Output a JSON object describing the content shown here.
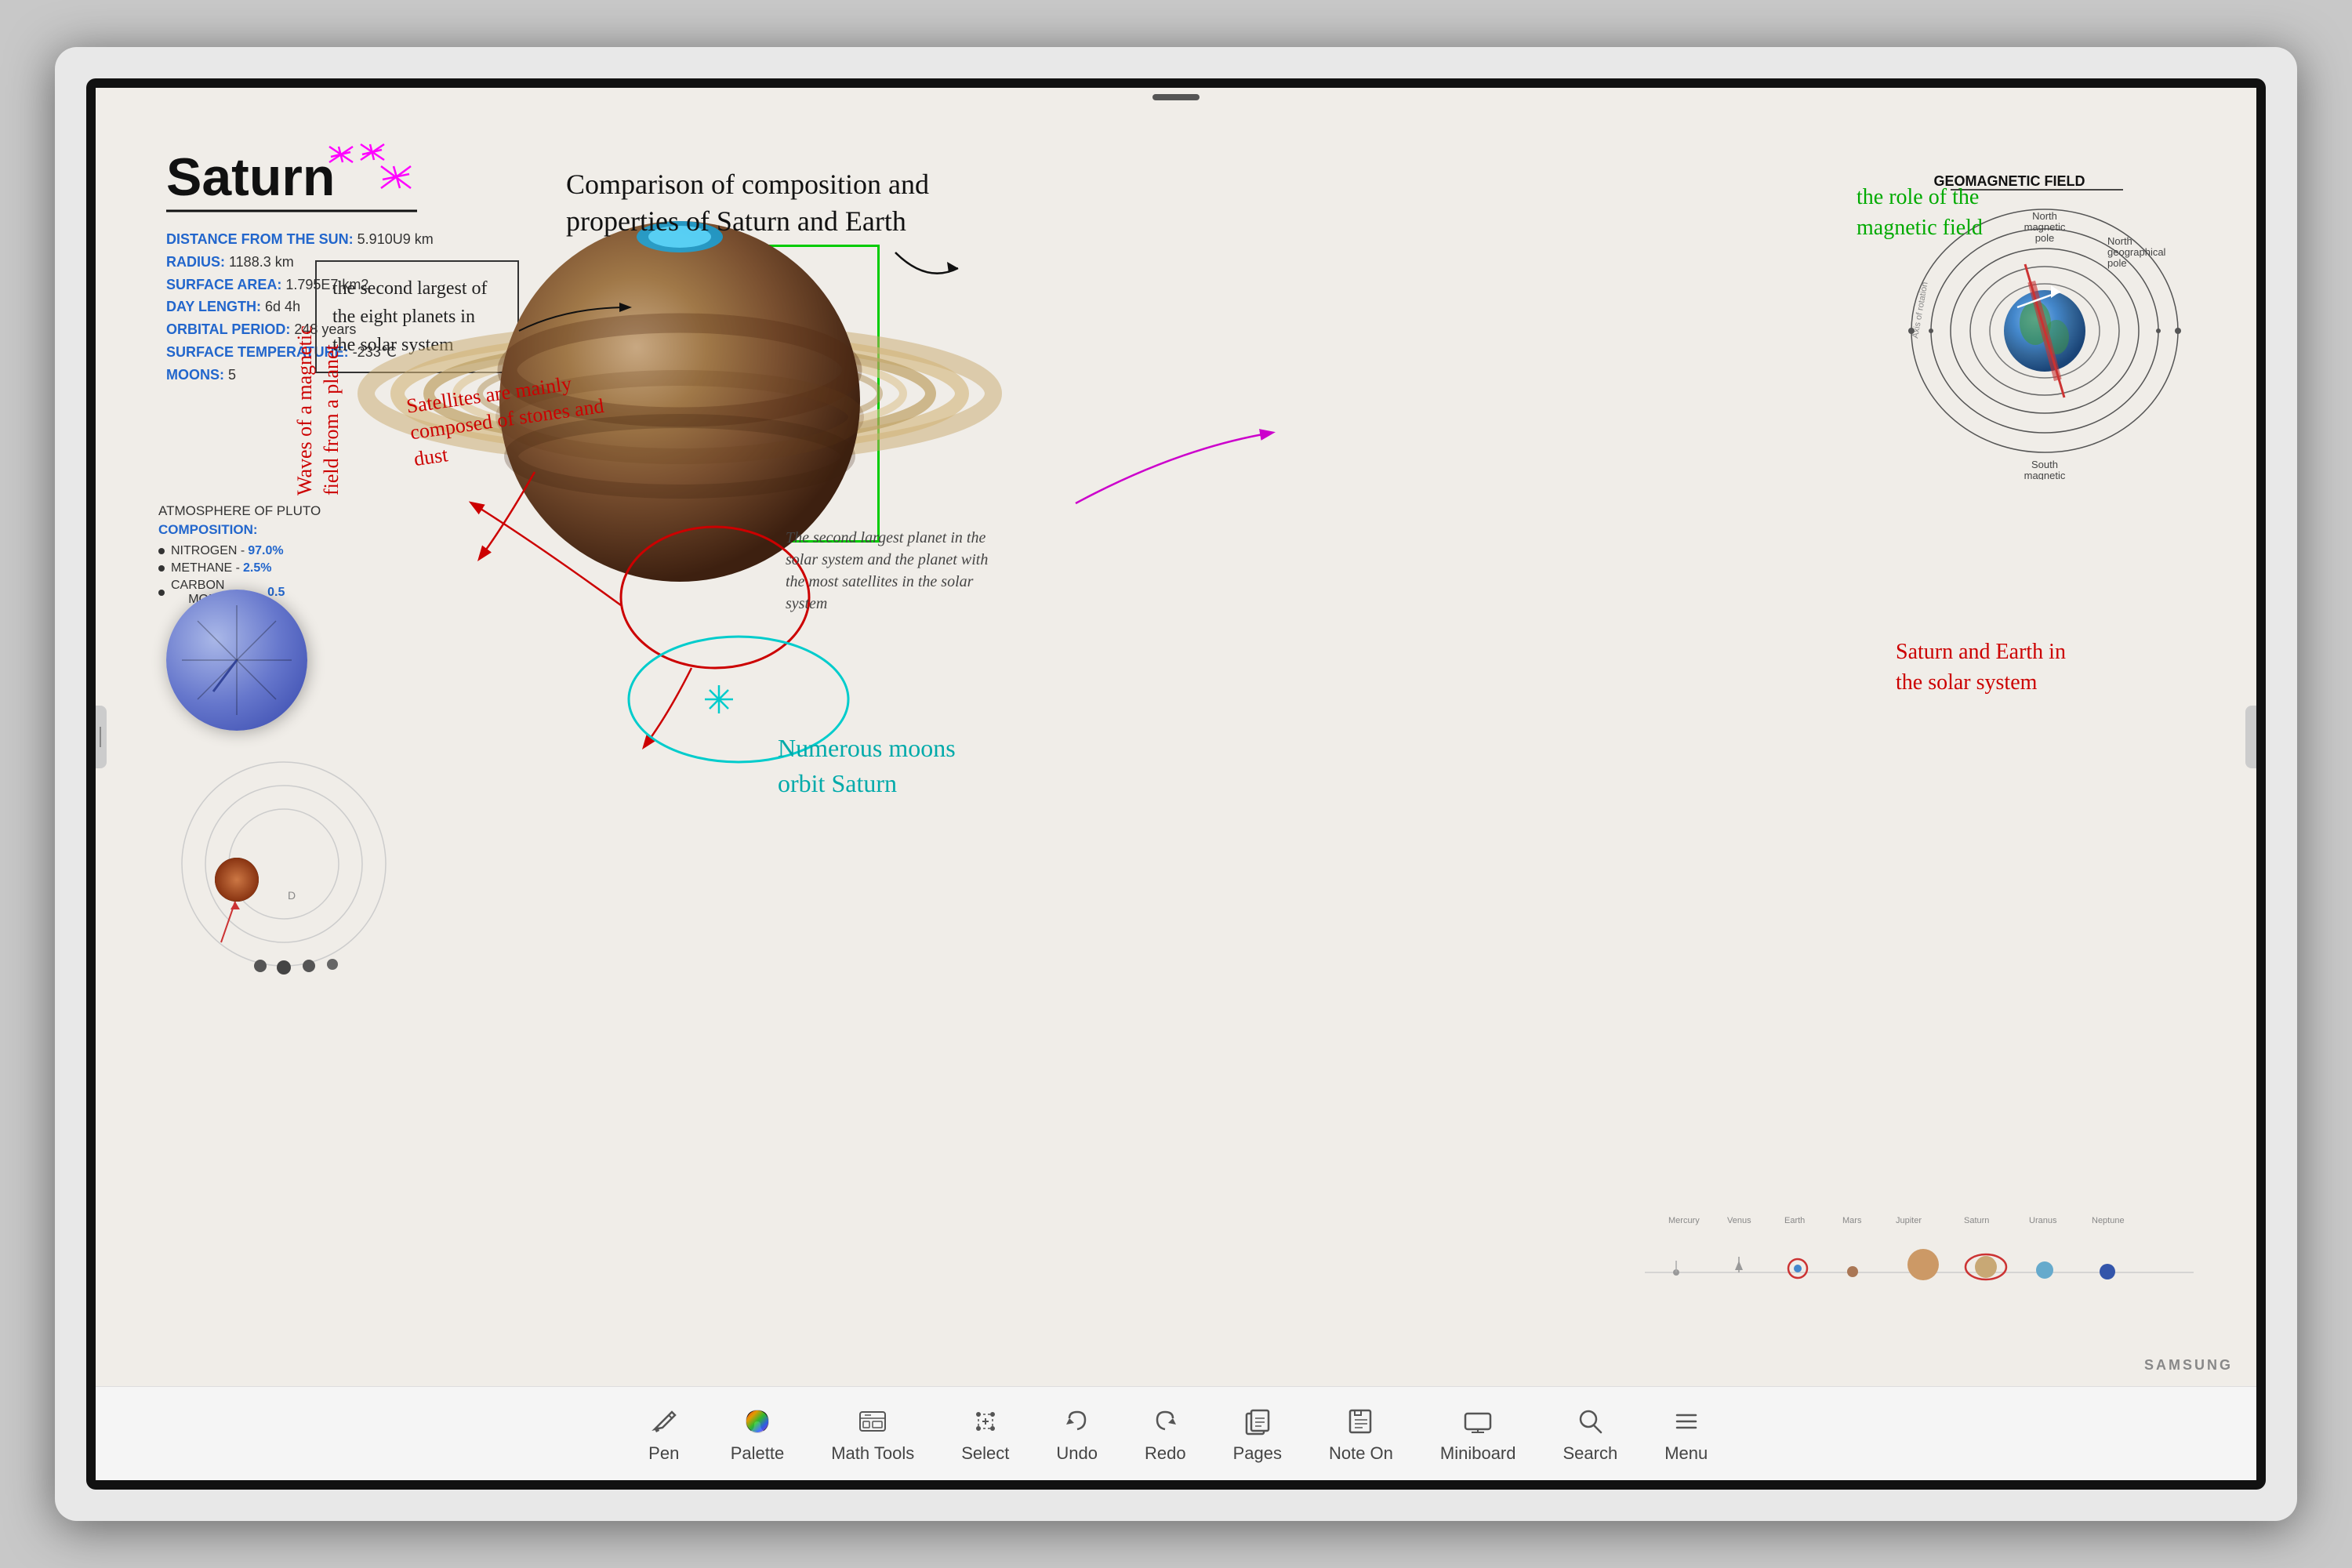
{
  "monitor": {
    "brand": "SAMSUNG"
  },
  "header": {
    "title": "Comparison of composition and properties of Saturn and Earth",
    "subtitle": "the role of the magnetic field"
  },
  "saturn": {
    "title": "Saturn",
    "stats": [
      {
        "label": "DISTANCE FROM THE SUN:",
        "value": "5.910U9 km"
      },
      {
        "label": "RADIUS:",
        "value": "1188.3 km"
      },
      {
        "label": "SURFACE AREA:",
        "value": "1.795E7 km2"
      },
      {
        "label": "DAY LENGTH:",
        "value": "6d 4h"
      },
      {
        "label": "ORBITAL PERIOD:",
        "value": "248 years"
      },
      {
        "label": "SURFACE TEMPERATURE:",
        "value": "-233℃"
      },
      {
        "label": "MOONS:",
        "value": "5"
      }
    ]
  },
  "atmosphere": {
    "title": "ATMOSPHERE OF PLUTO",
    "subtitle": "COMPOSITION:",
    "items": [
      {
        "name": "NITROGEN",
        "value": "97.0%"
      },
      {
        "name": "METHANE",
        "value": "2.5%"
      },
      {
        "name": "CARBON MONOXIDE",
        "value": "0.5"
      }
    ]
  },
  "textbox": {
    "content": "the second largest of the eight planets in the solar system"
  },
  "annotations": {
    "satellites": "Satellites are mainly composed of stones and dust",
    "waves": "Waves of a magnetic field from a planet",
    "moons": "Numerous moons orbit Saturn",
    "second_largest": "The second largest planet in the solar system and the planet with the most satellites in the solar system",
    "saturn_earth": "Saturn and Earth in the solar system",
    "geomagnetic": "GEOMAGNETIC FIELD"
  },
  "toolbar": {
    "items": [
      {
        "id": "pen",
        "label": "Pen",
        "icon": "✏️"
      },
      {
        "id": "palette",
        "label": "Palette",
        "icon": "🎨"
      },
      {
        "id": "math-tools",
        "label": "Math Tools",
        "icon": "📊"
      },
      {
        "id": "select",
        "label": "Select",
        "icon": "⊹"
      },
      {
        "id": "undo",
        "label": "Undo",
        "icon": "↩"
      },
      {
        "id": "redo",
        "label": "Redo",
        "icon": "↪"
      },
      {
        "id": "pages",
        "label": "Pages",
        "icon": "▭"
      },
      {
        "id": "note-on",
        "label": "Note On",
        "icon": "✎"
      },
      {
        "id": "miniboard",
        "label": "Miniboard",
        "icon": "▱"
      },
      {
        "id": "search",
        "label": "Search",
        "icon": "🔍"
      },
      {
        "id": "menu",
        "label": "Menu",
        "icon": "☰"
      }
    ]
  }
}
